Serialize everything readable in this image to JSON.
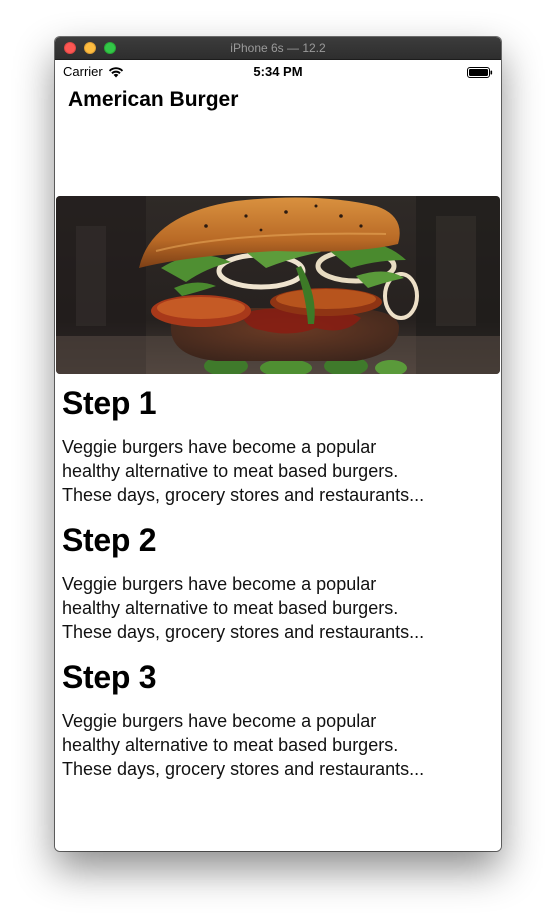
{
  "window": {
    "title": "iPhone 6s — 12.2"
  },
  "status_bar": {
    "carrier": "Carrier",
    "time": "5:34 PM",
    "icons": [
      "wifi-icon",
      "battery-icon"
    ]
  },
  "nav": {
    "title": "American Burger"
  },
  "hero_image": {
    "subject": "burger-photo",
    "colors": {
      "bun": "#c47a33",
      "patty": "#4a2f24",
      "tomato": "#b0421a",
      "greens": "#4f8f32",
      "background": "#2a2422"
    }
  },
  "steps": [
    {
      "title": "Step 1",
      "lines": [
        "Veggie burgers have become a popular",
        "healthy alternative to meat based burgers.",
        "These days, grocery stores and restaurants..."
      ]
    },
    {
      "title": "Step 2",
      "lines": [
        "Veggie burgers have become a popular",
        "healthy alternative to meat based burgers.",
        "These days, grocery stores and restaurants..."
      ]
    },
    {
      "title": "Step 3",
      "lines": [
        "Veggie burgers have become a popular",
        "healthy alternative to meat based burgers.",
        "These days, grocery stores and restaurants..."
      ]
    }
  ]
}
